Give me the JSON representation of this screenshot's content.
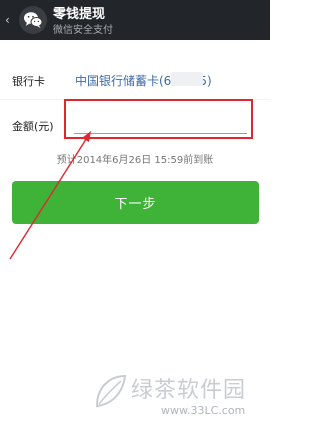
{
  "header": {
    "title": "零钱提现",
    "subtitle": "微信安全支付",
    "back_icon": "‹"
  },
  "form": {
    "bank_card_label": "银行卡",
    "bank_card_value": "中国银行储蓄卡(6",
    "bank_card_suffix": "5)",
    "amount_label": "金额(元)",
    "amount_value": "",
    "arrival_note": "预计2014年6月26日 15:59前到账"
  },
  "actions": {
    "next_label": "下一步"
  },
  "watermark": {
    "text": "绿茶软件园",
    "url": "www.33LC.com"
  },
  "colors": {
    "header_bg": "#222529",
    "accent_green": "#3fb338",
    "annotation_red": "#e0262f",
    "link_blue": "#3d6ba8"
  }
}
